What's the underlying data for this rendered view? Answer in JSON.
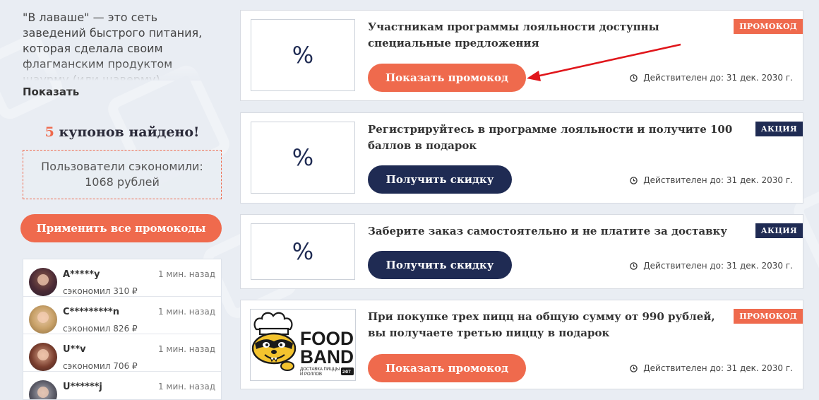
{
  "sidebar": {
    "about": "\"В лаваше\" — это сеть заведений быстрого питания, которая сделала своим флагманским продуктом шаурму (или шаверму), приготовленную по авторским",
    "show_more": "Показать",
    "found": {
      "count": "5",
      "text": "купонов найдено!"
    },
    "savings": "Пользователи сэкономили: 1068 рублей",
    "apply_all": "Применить все промокоды",
    "users": [
      {
        "name": "A*****y",
        "time": "1 мин. назад",
        "saved": "сэкономил 310 ₽",
        "avatar": "avatar-1"
      },
      {
        "name": "C*********n",
        "time": "1 мин. назад",
        "saved": "сэкономил 826 ₽",
        "avatar": "avatar-2"
      },
      {
        "name": "U**v",
        "time": "1 мин. назад",
        "saved": "сэкономил 706 ₽",
        "avatar": "avatar-3"
      },
      {
        "name": "U******j",
        "time": "1 мин. назад",
        "saved": "",
        "avatar": "avatar-4"
      }
    ]
  },
  "coupons": [
    {
      "title": "Участникам программы лояльности доступны специальные предложения",
      "badge": "ПРОМОКОД",
      "button": "Показать промокод",
      "expiry": "Действителен до: 31 дек. 2030 г.",
      "thumb": "%"
    },
    {
      "title": "Регистрируйтесь в программе лояльности и получите 100 баллов в подарок",
      "badge": "АКЦИЯ",
      "button": "Получить скидку",
      "expiry": "Действителен до: 31 дек. 2030 г.",
      "thumb": "%"
    },
    {
      "title": "Заберите заказ самостоятельно и не платите за доставку",
      "badge": "АКЦИЯ",
      "button": "Получить скидку",
      "expiry": "Действителен до: 31 дек. 2030 г.",
      "thumb": "%"
    },
    {
      "title": "При покупке трех пицц на общую сумму от 990 рублей, вы получаете третью пиццу в подарок",
      "badge": "ПРОМОКОД",
      "button": "Показать промокод",
      "expiry": "Действителен до: 31 дек. 2030 г.",
      "logo": {
        "line1": "FOOD",
        "line2": "BAND",
        "sub1": "ДОСТАВКА ПИЦЦЫ",
        "sub2": "И РОЛЛОВ",
        "tag": "24/7"
      }
    }
  ],
  "colors": {
    "accent": "#ef6a4d",
    "navy": "#1f2b53",
    "annotation_arrow": "#e0161b"
  },
  "icons": {
    "clock": "clock-icon",
    "percent": "percent-icon",
    "arrow": "red-arrow-annotation"
  }
}
